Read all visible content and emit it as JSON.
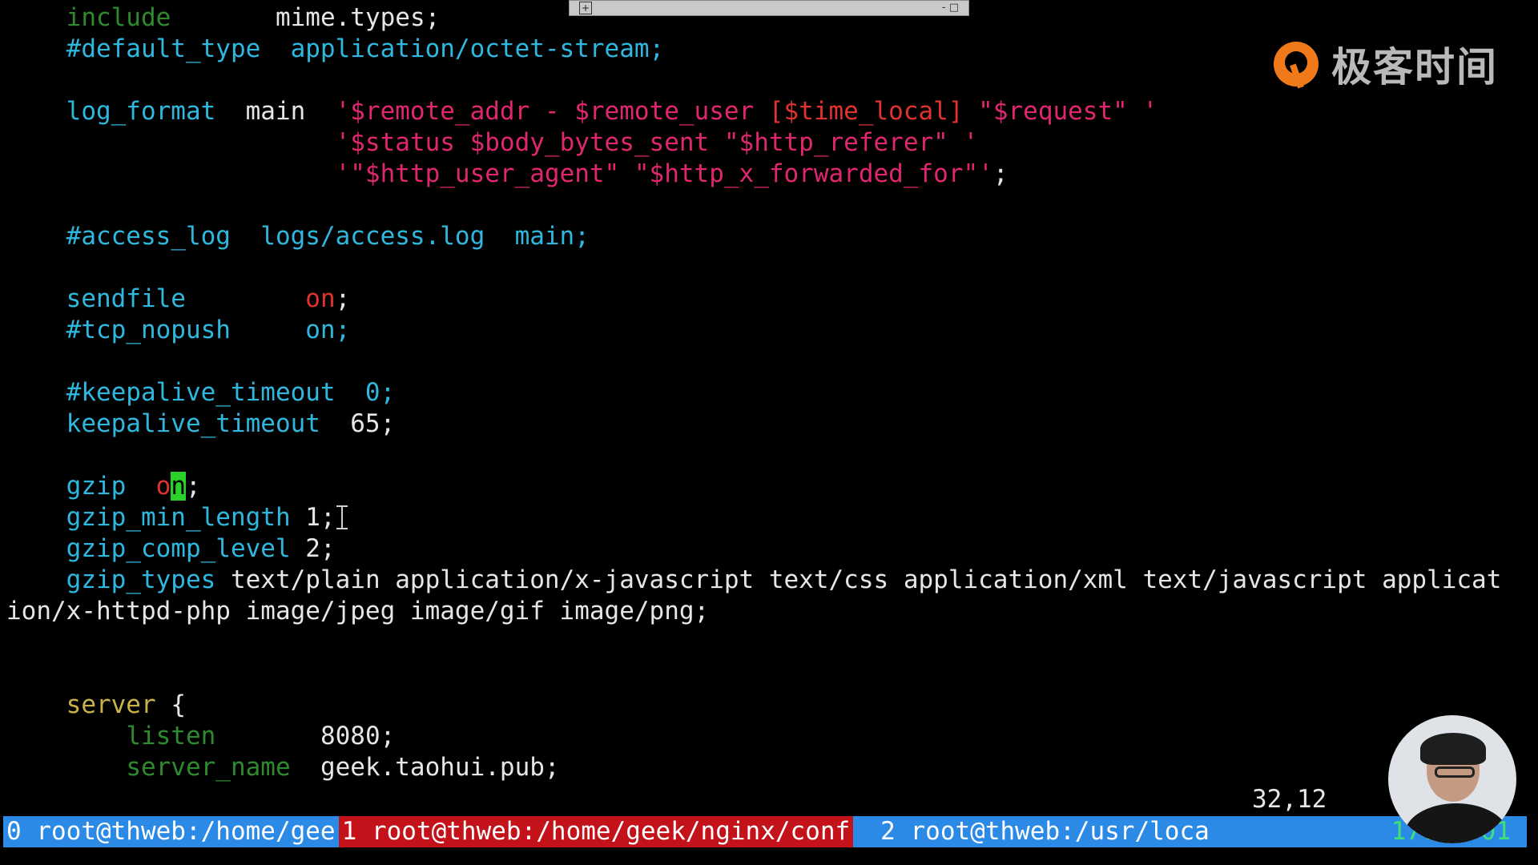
{
  "window": {
    "minimize_symbol": "-",
    "restore_symbol": "□"
  },
  "editor": {
    "line01": {
      "directive": "include",
      "value": "mime.types;"
    },
    "line02": {
      "text": "#default_type  application/octet-stream;"
    },
    "line04": {
      "directive": "log_format",
      "name": "main",
      "str_a": "'$remote_addr - $remote_user ",
      "str_b": "[$time_local]",
      "str_c": " \"$request\" '"
    },
    "line05": {
      "str": "'$status $body_bytes_sent \"$http_referer\" '"
    },
    "line06": {
      "str": "'\"$http_user_agent\" \"$http_x_forwarded_for\"'",
      "end": ";"
    },
    "line08": {
      "text": "#access_log  logs/access.log  main;"
    },
    "line10": {
      "directive": "sendfile",
      "value": "on",
      "end": ";"
    },
    "line11": {
      "text": "#tcp_nopush     on;"
    },
    "line13": {
      "text": "#keepalive_timeout  0;"
    },
    "line14": {
      "directive": "keepalive_timeout",
      "value": "65;"
    },
    "line16": {
      "directive": "gzip",
      "value_start": "o",
      "cursor_char": "n",
      "end": ";"
    },
    "line17": {
      "directive": "gzip_min_length",
      "value": "1;"
    },
    "line18": {
      "directive": "gzip_comp_level",
      "value": "2;"
    },
    "line19": {
      "directive": "gzip_types",
      "value": "text/plain application/x-javascript text/css application/xml text/javascript applicat"
    },
    "line20": {
      "text": "ion/x-httpd-php image/jpeg image/gif image/png;"
    },
    "line23": {
      "directive": "server",
      "brace": "{"
    },
    "line24": {
      "directive": "listen",
      "value": "8080;"
    },
    "line25": {
      "directive": "server_name",
      "value": "geek.taohui.pub;"
    }
  },
  "cursor_position": "32,12",
  "statusbar": {
    "windows": [
      {
        "label": "0 root@thweb:/home/gee",
        "active": false
      },
      {
        "label": "1 root@thweb:/home/geek/nginx/conf",
        "active": true
      },
      {
        "label": "2 root@thweb:/usr/loca",
        "active": false
      }
    ],
    "clock": "17:39:01"
  },
  "logo": {
    "text": "极客时间"
  },
  "colors": {
    "background": "#000000",
    "directive": "#2fb8df",
    "string": "#e0266e",
    "on_value": "#e0322e",
    "cursor": "#2bd12b",
    "statusbar": "#2a8ae6",
    "active_window": "#c4121a",
    "logo_orange": "#f07a1a"
  }
}
